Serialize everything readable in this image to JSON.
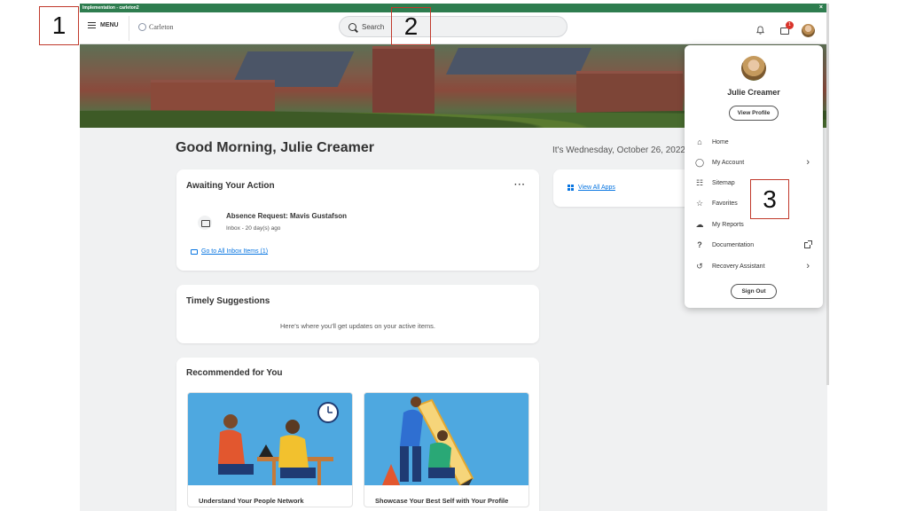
{
  "env_bar": {
    "title": "Implementation - carleton2",
    "close": "×"
  },
  "topbar": {
    "menu_label": "MENU",
    "logo_text": "Carleton",
    "search_placeholder": "Search",
    "inbox_badge": "1"
  },
  "main": {
    "greeting": "Good Morning, Julie Creamer",
    "date_text": "It's Wednesday, October 26, 2022"
  },
  "awaiting": {
    "title": "Awaiting Your Action",
    "more": "···",
    "item_title": "Absence Request: Mavis Gustafson",
    "item_sub": "Inbox - 20 day(s) ago",
    "link": "Go to All Inbox Items (1)"
  },
  "apps": {
    "link": "View All Apps"
  },
  "suggestions": {
    "title": "Timely Suggestions",
    "empty_text": "Here's where you'll get updates on your active items."
  },
  "recommended": {
    "title": "Recommended for You",
    "cards": [
      {
        "label": "Understand Your People Network"
      },
      {
        "label": "Showcase Your Best Self with Your Profile"
      }
    ]
  },
  "profile_menu": {
    "name": "Julie Creamer",
    "view_profile": "View Profile",
    "items": [
      {
        "label": "Home",
        "icon": "home-icon",
        "glyph": "⌂"
      },
      {
        "label": "My Account",
        "icon": "person-icon",
        "glyph": "◯"
      },
      {
        "label": "Sitemap",
        "icon": "sitemap-icon",
        "glyph": "☷"
      },
      {
        "label": "Favorites",
        "icon": "star-icon",
        "glyph": "☆"
      },
      {
        "label": "My Reports",
        "icon": "cloud-icon",
        "glyph": "☁"
      },
      {
        "label": "Documentation",
        "icon": "question-icon",
        "glyph": "?"
      },
      {
        "label": "Recovery Assistant",
        "icon": "history-icon",
        "glyph": "↺"
      }
    ],
    "chevron": "›",
    "sign_out": "Sign Out"
  },
  "callouts": [
    "1",
    "2",
    "3"
  ],
  "colors": {
    "env_bar": "#2e7d4f",
    "link": "#0875e1",
    "badge": "#d9342b",
    "callout_border": "#c0392b"
  }
}
